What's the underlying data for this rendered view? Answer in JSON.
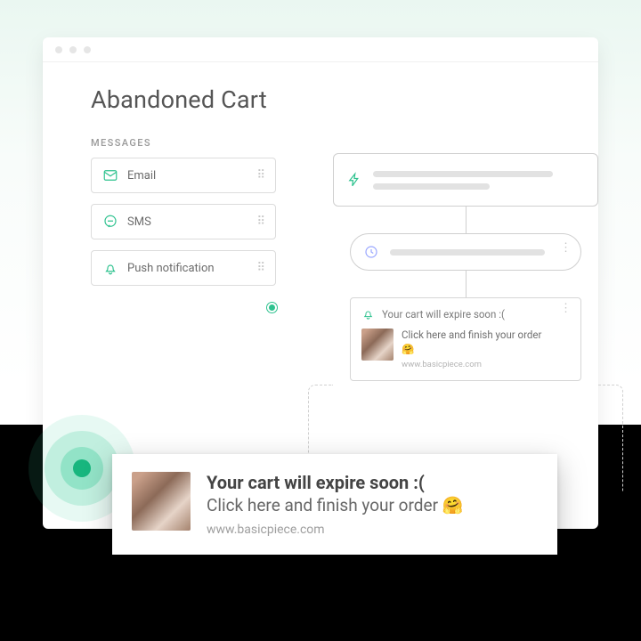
{
  "colors": {
    "accent": "#2fc28f"
  },
  "page": {
    "title": "Abandoned Cart"
  },
  "messages": {
    "section_label": "MESSAGES",
    "items": [
      {
        "label": "Email",
        "icon": "mail"
      },
      {
        "label": "SMS",
        "icon": "chat"
      },
      {
        "label": "Push notification",
        "icon": "bell"
      }
    ]
  },
  "flow": {
    "trigger_icon": "bolt",
    "wait_icon": "clock",
    "preview": {
      "icon": "bell",
      "title": "Your cart will expire soon :(",
      "body": "Click here and finish your order 🤗",
      "source": "www.basicpiece.com"
    }
  },
  "toast": {
    "title": "Your cart will expire soon :(",
    "body": "Click here and finish your order 🤗",
    "source": "www.basicpiece.com"
  }
}
